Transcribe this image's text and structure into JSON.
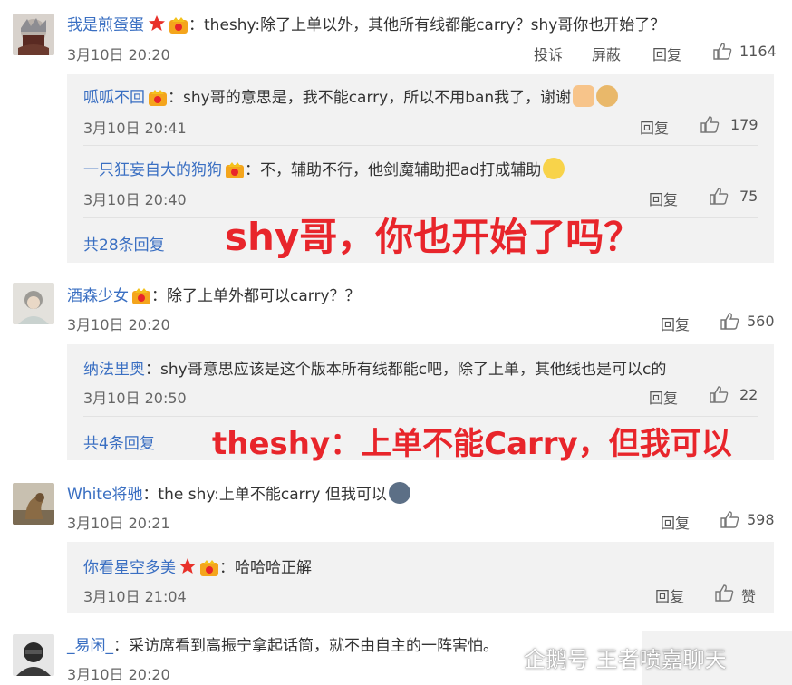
{
  "comments": [
    {
      "user": "我是煎蛋蛋",
      "text": "：theshy:除了上单以外，其他所有线都能carry？shy哥你也开始了？",
      "time": "3月10日 20:20",
      "actions": {
        "report": "投诉",
        "block": "屏蔽",
        "reply": "回复",
        "likes": "1164"
      },
      "replies": [
        {
          "user": "呱呱不回",
          "text": "：shy哥的意思是，我不能carry，所以不用ban我了，谢谢",
          "time": "3月10日 20:41",
          "reply": "回复",
          "likes": "179"
        },
        {
          "user": "一只狂妄自大的狗狗",
          "text": "：不，辅助不行，他剑魔辅助把ad打成辅助",
          "time": "3月10日 20:40",
          "reply": "回复",
          "likes": "75"
        }
      ],
      "more": "共28条回复"
    },
    {
      "user": "酒森少女",
      "text": "：除了上单外都可以carry？？",
      "time": "3月10日 20:20",
      "actions": {
        "reply": "回复",
        "likes": "560"
      },
      "replies": [
        {
          "user": "纳法里奥",
          "text": "：shy哥意思应该是这个版本所有线都能c吧，除了上单，其他线也是可以c的",
          "time": "3月10日 20:50",
          "reply": "回复",
          "likes": "22"
        }
      ],
      "more": "共4条回复"
    },
    {
      "user": "White将驰",
      "text": "：the shy:上单不能carry 但我可以",
      "time": "3月10日 20:21",
      "actions": {
        "reply": "回复",
        "likes": "598"
      },
      "replies": [
        {
          "user": "你看星空多美",
          "text": "：哈哈哈正解",
          "time": "3月10日 21:04",
          "reply": "回复",
          "likes": "赞"
        }
      ]
    },
    {
      "user": "_易闲_",
      "text": "：采访席看到高振宁拿起话筒，就不由自主的一阵害怕。",
      "time": "3月10日 20:20"
    }
  ],
  "overlays": {
    "caption1": "shy哥，你也开始了吗？",
    "caption2": "theshy：上单不能Carry，但我可以"
  },
  "watermark": {
    "text": "企鹅号 王者喷嘉聊天"
  },
  "colors": {
    "link": "#3a6fc2",
    "caption": "#e8252b",
    "reply_bg": "#f2f2f2"
  }
}
